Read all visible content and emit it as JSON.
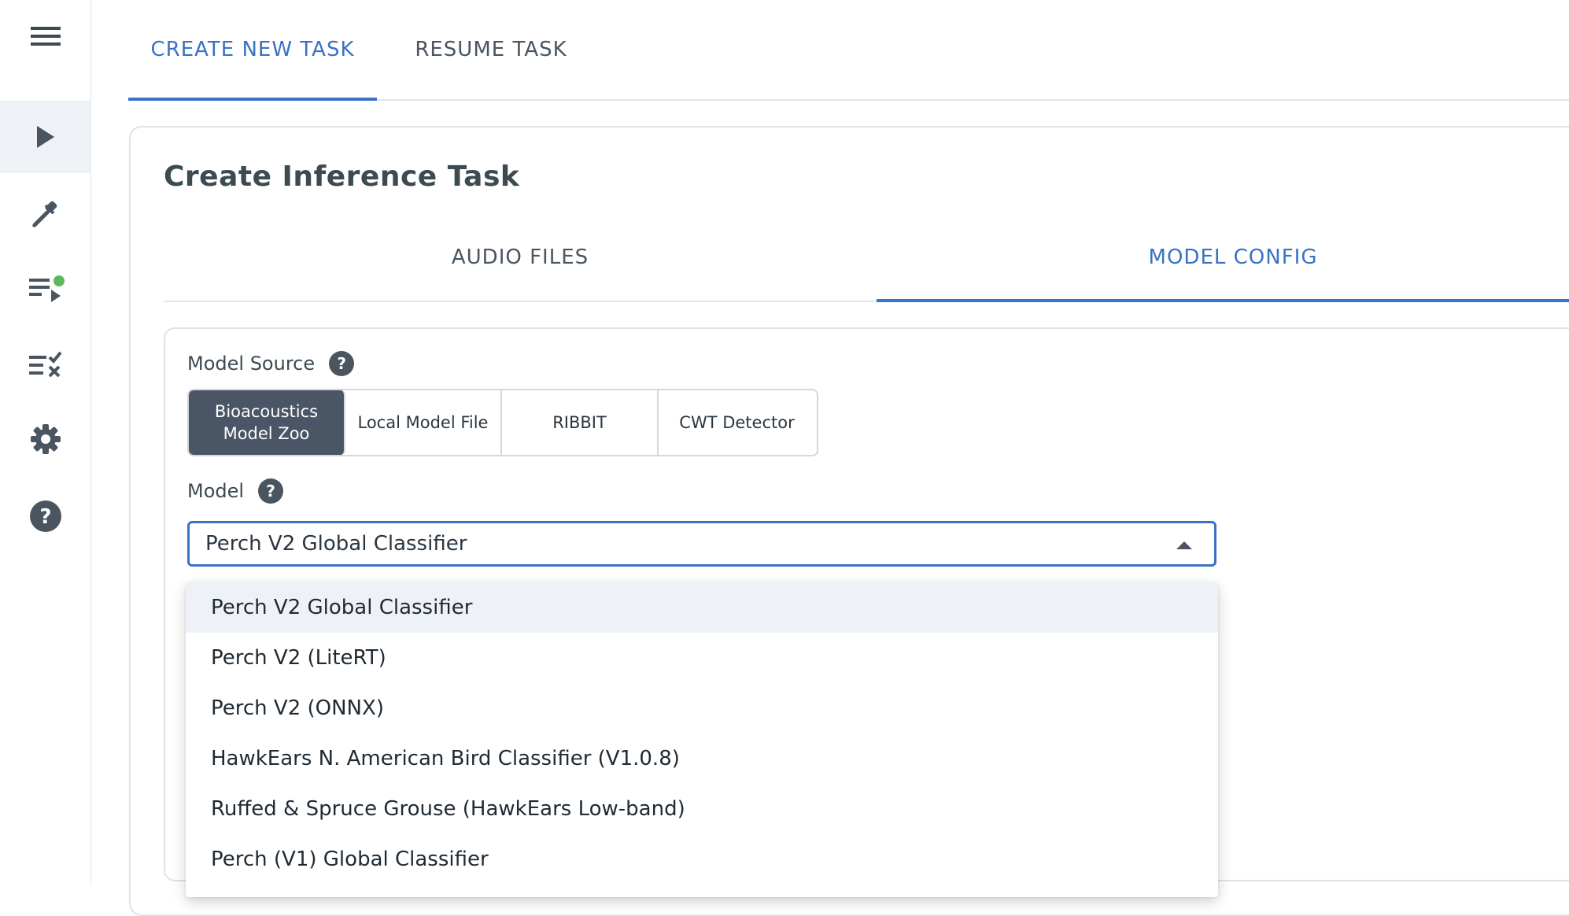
{
  "sidebar": {
    "items": [
      {
        "icon": "menu-icon"
      },
      {
        "icon": "play-icon",
        "active": true
      },
      {
        "icon": "eyedropper-icon"
      },
      {
        "icon": "queue-play-icon",
        "notification": true
      },
      {
        "icon": "checklist-icon"
      },
      {
        "icon": "gear-icon"
      },
      {
        "icon": "help-icon"
      }
    ]
  },
  "top_tabs": [
    {
      "label": "CREATE NEW TASK",
      "active": true
    },
    {
      "label": "RESUME TASK",
      "active": false
    }
  ],
  "card": {
    "title": "Create Inference Task",
    "tabs": [
      {
        "label": "AUDIO FILES",
        "active": false
      },
      {
        "label": "MODEL CONFIG",
        "active": true
      }
    ]
  },
  "model_source": {
    "label": "Model Source",
    "help": "?",
    "options": [
      {
        "label": "Bioacoustics\nModel Zoo",
        "active": true
      },
      {
        "label": "Local Model File",
        "active": false
      },
      {
        "label": "RIBBIT",
        "active": false
      },
      {
        "label": "CWT Detector",
        "active": false
      }
    ]
  },
  "model": {
    "label": "Model",
    "help": "?",
    "selected": "Perch V2 Global Classifier",
    "options": [
      "Perch V2 Global Classifier",
      "Perch V2 (LiteRT)",
      "Perch V2 (ONNX)",
      "HawkEars N. American Bird Classifier (V1.0.8)",
      "Ruffed & Spruce Grouse (HawkEars Low-band)",
      "Perch (V1) Global Classifier"
    ]
  },
  "colors": {
    "accent": "#3a72c4",
    "active_segment": "#4a5566",
    "notification": "#5cb85c"
  }
}
